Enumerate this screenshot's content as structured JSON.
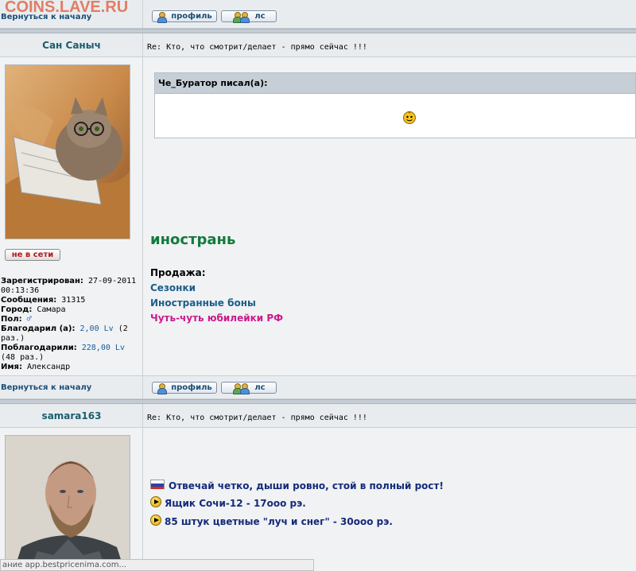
{
  "watermark": "COINS.LAVE.RU",
  "back_to_top": "Вернуться к началу",
  "buttons": {
    "profile": "профиль",
    "pm": "лс"
  },
  "posts": [
    {
      "username": "Сан Саныч",
      "title": "Re: Кто, что смотрит/делает - прямо сейчас !!!",
      "status": "не в сети",
      "info": {
        "registered_label": "Зарегистрирован:",
        "registered_value": "27-09-2011 00:13:36",
        "messages_label": "Сообщения:",
        "messages_value": "31315",
        "city_label": "Город:",
        "city_value": "Самара",
        "gender_label": "Пол:",
        "thanked_label": "Благодарил (а):",
        "thanked_value": "2,00 Lv",
        "thanked_count": "(2 раз.)",
        "got_thanks_label": "Поблагодарили:",
        "got_thanks_value": "228,00 Lv",
        "got_thanks_count": "(48 раз.)",
        "name_label": "Имя:",
        "name_value": "Александр"
      },
      "quote_author": "Че_Буратор писал(а):",
      "signature_title": "инострань",
      "sale_label": "Продажа:",
      "sale_links": [
        "Сезонки",
        "Иностранные боны",
        "Чуть-чуть юбилейки РФ"
      ]
    },
    {
      "username": "samara163",
      "title": "Re: Кто, что смотрит/делает - прямо сейчас !!!",
      "signature_lines": [
        "Отвечай четко, дыши ровно, стой в полный рост!",
        "Ящик Сочи-12 - 17ооо рэ.",
        "85 штук цветные \"луч и снег\" - 30ооо рэ."
      ]
    }
  ],
  "status_bar": "ание app.bestpricenima.com..."
}
